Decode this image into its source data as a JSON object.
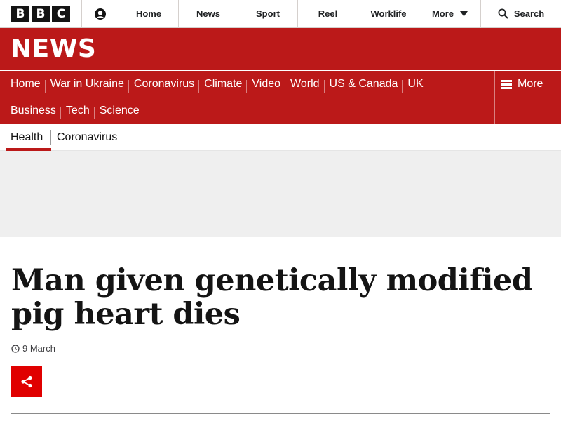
{
  "global_nav": {
    "logo_letters": [
      "B",
      "B",
      "C"
    ],
    "account_icon": "user-icon",
    "items": [
      "Home",
      "News",
      "Sport",
      "Reel",
      "Worklife"
    ],
    "more_label": "More",
    "search_label": "Search"
  },
  "masthead": {
    "title": "NEWS",
    "color": "#bb1919"
  },
  "section_nav": {
    "row1": [
      "Home",
      "War in Ukraine",
      "Coronavirus",
      "Climate",
      "Video",
      "World",
      "US & Canada",
      "UK"
    ],
    "row2": [
      "Business",
      "Tech",
      "Science"
    ],
    "more_label": "More"
  },
  "sub_nav": {
    "items": [
      "Health",
      "Coronavirus"
    ],
    "active": "Health"
  },
  "article": {
    "headline": "Man given genetically modified pig heart dies",
    "timestamp": "9 March",
    "share_icon": "share-icon",
    "share_color": "#e00000"
  }
}
